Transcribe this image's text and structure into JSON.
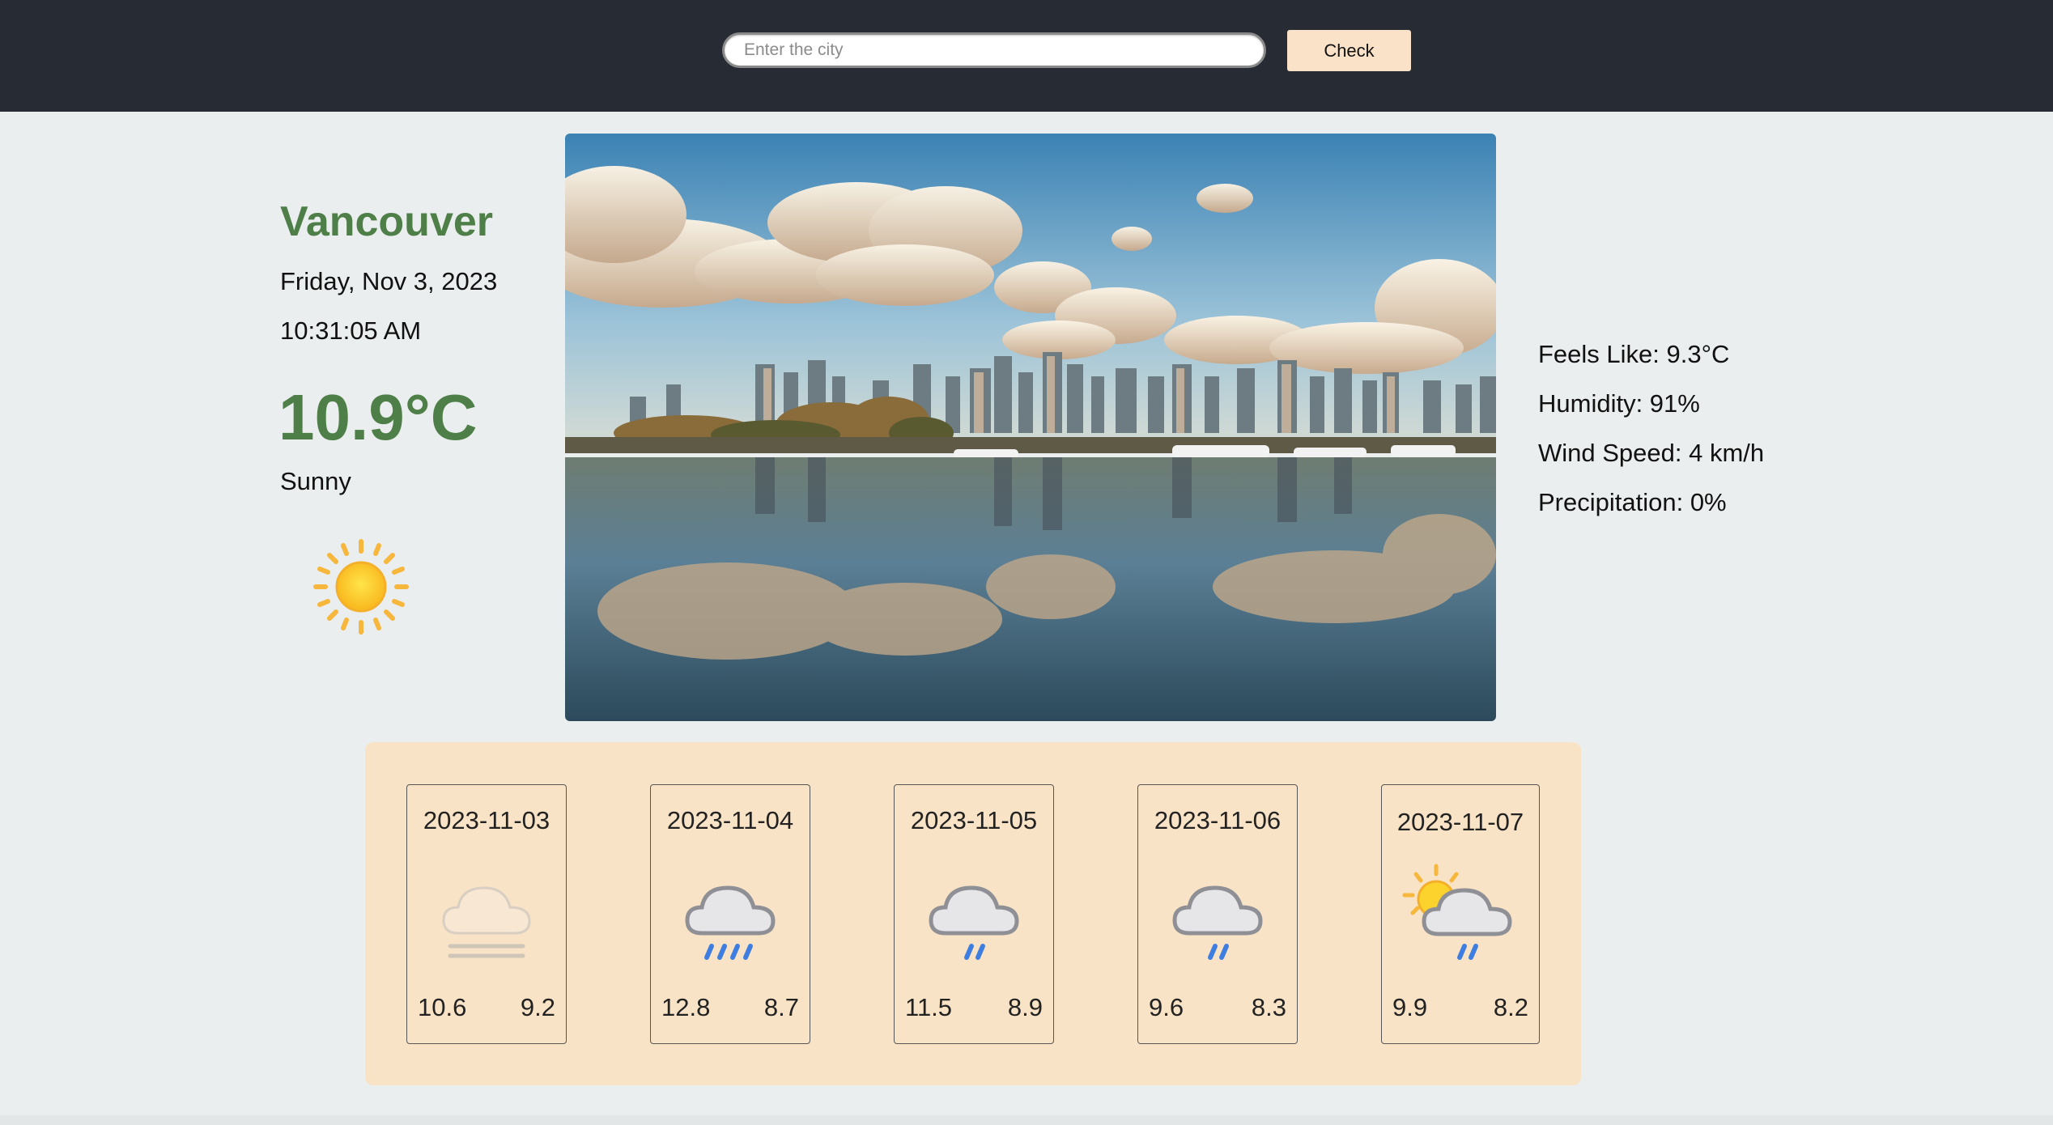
{
  "search": {
    "placeholder": "Enter the city",
    "button_label": "Check"
  },
  "current": {
    "city": "Vancouver",
    "date": "Friday, Nov 3, 2023",
    "time": "10:31:05 AM",
    "temperature": "10.9°C",
    "condition": "Sunny",
    "icon": "sun-icon"
  },
  "details": {
    "feels_like": "Feels Like: 9.3°C",
    "humidity": "Humidity: 91%",
    "wind_speed": "Wind Speed: 4 km/h",
    "precipitation": "Precipitation: 0%"
  },
  "forecast": [
    {
      "date": "2023-11-03",
      "high": "10.6",
      "low": "9.2",
      "icon": "fog-icon"
    },
    {
      "date": "2023-11-04",
      "high": "12.8",
      "low": "8.7",
      "icon": "heavy-rain-icon"
    },
    {
      "date": "2023-11-05",
      "high": "11.5",
      "low": "8.9",
      "icon": "light-rain-icon"
    },
    {
      "date": "2023-11-06",
      "high": "9.6",
      "low": "8.3",
      "icon": "light-rain-icon"
    },
    {
      "date": "2023-11-07",
      "high": "9.9",
      "low": "8.2",
      "icon": "sun-cloud-rain-icon"
    }
  ],
  "colors": {
    "topbar": "#272b33",
    "background": "#ebeeee",
    "accent_green": "#4f7f49",
    "panel": "#f9e3c6",
    "button": "#f9e2c8"
  }
}
